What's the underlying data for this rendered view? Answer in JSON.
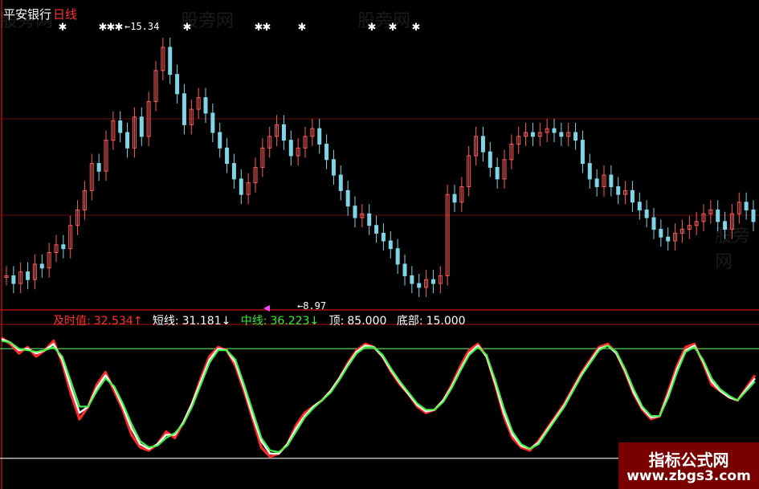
{
  "title": {
    "stock": "平安银行",
    "period": "日线"
  },
  "price_marks": {
    "high": "←15.34",
    "low": "←8.97"
  },
  "legend": [
    {
      "label": "及时值:",
      "value": "32.534↑",
      "color": "#ff3030"
    },
    {
      "label": "短线:",
      "value": "31.181↓",
      "color": "#ffffff"
    },
    {
      "label": "中线:",
      "value": "36.223↓",
      "color": "#33ee33"
    },
    {
      "label": "顶:",
      "value": "85.000",
      "color": "#ffffff"
    },
    {
      "label": "底部:",
      "value": "15.000",
      "color": "#ffffff"
    }
  ],
  "ghost_text": "股旁网",
  "watermark": {
    "line1": "指标公式网",
    "line2": "www.zbgs3.com"
  },
  "chart_data": [
    {
      "type": "candlestick",
      "series": [
        {
          "name": "",
          "values": [
            9.3,
            9.1,
            9.4,
            9.2,
            9.6,
            9.5,
            9.9,
            10.1,
            10.0,
            10.6,
            11.0,
            11.5,
            12.2,
            12.0,
            12.8,
            13.3,
            13.0,
            12.6,
            13.4,
            12.9,
            13.8,
            14.6,
            15.2,
            14.5,
            14.0,
            13.2,
            13.6,
            13.9,
            13.5,
            13.0,
            12.6,
            12.2,
            11.8,
            11.4,
            11.7,
            12.1,
            12.6,
            12.9,
            13.2,
            12.8,
            12.4,
            12.6,
            12.9,
            13.1,
            12.7,
            12.3,
            11.9,
            11.5,
            11.1,
            10.8,
            10.9,
            10.6,
            10.4,
            10.2,
            10.0,
            9.6,
            9.3,
            9.1,
            9.0,
            9.2,
            9.1,
            9.3,
            11.4,
            11.2,
            11.6,
            12.4,
            12.9,
            12.5,
            12.1,
            11.8,
            12.3,
            12.7,
            12.9,
            13.0,
            12.9,
            13.0,
            13.1,
            13.0,
            12.9,
            13.0,
            12.8,
            12.2,
            11.8,
            11.6,
            11.9,
            11.6,
            11.4,
            11.5,
            11.2,
            11.0,
            10.8,
            10.5,
            10.3,
            10.2,
            10.4,
            10.5,
            10.6,
            10.7,
            10.9,
            11.0,
            10.7,
            10.5,
            10.9,
            11.2,
            11.0,
            10.7
          ]
        }
      ],
      "ylim": [
        8.5,
        15.8
      ]
    },
    {
      "type": "line",
      "series": [
        {
          "name": "及时值",
          "values": [
            92,
            88,
            82,
            86,
            80,
            84,
            90,
            76,
            56,
            40,
            48,
            62,
            70,
            58,
            46,
            30,
            22,
            20,
            24,
            32,
            28,
            38,
            50,
            66,
            80,
            86,
            84,
            74,
            58,
            40,
            22,
            16,
            18,
            24,
            36,
            44,
            48,
            52,
            58,
            66,
            76,
            84,
            88,
            86,
            80,
            70,
            62,
            56,
            48,
            44,
            46,
            52,
            62,
            74,
            84,
            88,
            80,
            62,
            42,
            28,
            22,
            20,
            26,
            34,
            42,
            50,
            60,
            70,
            78,
            86,
            88,
            82,
            70,
            56,
            46,
            40,
            42,
            58,
            74,
            86,
            88,
            76,
            62,
            58,
            54,
            52,
            60,
            68
          ]
        },
        {
          "name": "短线",
          "values": [
            91,
            89,
            84,
            85,
            82,
            84,
            88,
            78,
            60,
            44,
            48,
            60,
            68,
            60,
            48,
            34,
            24,
            21,
            24,
            30,
            30,
            38,
            50,
            64,
            78,
            85,
            84,
            76,
            60,
            42,
            26,
            18,
            18,
            24,
            34,
            42,
            48,
            52,
            58,
            66,
            75,
            83,
            87,
            86,
            80,
            71,
            63,
            56,
            49,
            45,
            46,
            52,
            61,
            72,
            82,
            87,
            80,
            63,
            44,
            30,
            23,
            21,
            25,
            33,
            41,
            49,
            59,
            69,
            77,
            85,
            87,
            82,
            71,
            57,
            47,
            41,
            42,
            56,
            72,
            84,
            87,
            77,
            64,
            58,
            54,
            52,
            59,
            66
          ]
        },
        {
          "name": "中线",
          "values": [
            90,
            89,
            85,
            84,
            83,
            84,
            86,
            80,
            64,
            48,
            48,
            58,
            66,
            61,
            50,
            37,
            26,
            22,
            23,
            28,
            31,
            37,
            48,
            62,
            76,
            84,
            84,
            78,
            62,
            45,
            28,
            20,
            19,
            23,
            32,
            41,
            47,
            52,
            57,
            65,
            74,
            82,
            86,
            86,
            81,
            72,
            64,
            57,
            50,
            46,
            46,
            51,
            60,
            71,
            81,
            86,
            81,
            65,
            47,
            32,
            24,
            21,
            24,
            32,
            40,
            48,
            58,
            68,
            76,
            84,
            87,
            83,
            72,
            59,
            48,
            42,
            42,
            54,
            70,
            83,
            86,
            78,
            66,
            59,
            55,
            52,
            58,
            64
          ]
        }
      ],
      "ylim": [
        0,
        100
      ],
      "reference_lines": [
        85,
        15
      ]
    }
  ]
}
